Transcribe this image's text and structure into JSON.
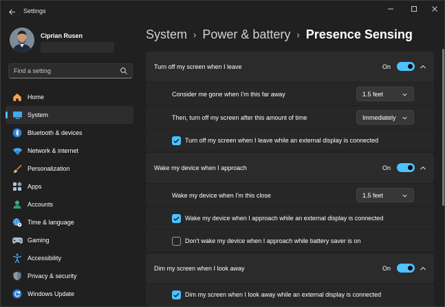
{
  "app": {
    "title": "Settings"
  },
  "user": {
    "name": "Ciprian Rusen"
  },
  "search": {
    "placeholder": "Find a setting"
  },
  "sidebar": {
    "items": [
      {
        "label": "Home",
        "icon": "home-icon"
      },
      {
        "label": "System",
        "icon": "system-icon",
        "active": true
      },
      {
        "label": "Bluetooth & devices",
        "icon": "bluetooth-icon"
      },
      {
        "label": "Network & internet",
        "icon": "wifi-icon"
      },
      {
        "label": "Personalization",
        "icon": "brush-icon"
      },
      {
        "label": "Apps",
        "icon": "apps-icon"
      },
      {
        "label": "Accounts",
        "icon": "accounts-icon"
      },
      {
        "label": "Time & language",
        "icon": "globe-clock-icon"
      },
      {
        "label": "Gaming",
        "icon": "gamepad-icon"
      },
      {
        "label": "Accessibility",
        "icon": "accessibility-icon"
      },
      {
        "label": "Privacy & security",
        "icon": "shield-icon"
      },
      {
        "label": "Windows Update",
        "icon": "update-icon"
      }
    ]
  },
  "breadcrumb": {
    "level1": "System",
    "level2": "Power & battery",
    "current": "Presence Sensing"
  },
  "sections": {
    "leave": {
      "title": "Turn off my screen when I leave",
      "state": "On",
      "distance_label": "Consider me gone when I'm this far away",
      "distance_value": "1.5 feet",
      "delay_label": "Then, turn off my screen after this amount of time",
      "delay_value": "Immediately",
      "external_label": "Turn off my screen when I leave while an external display is connected"
    },
    "approach": {
      "title": "Wake my device when I approach",
      "state": "On",
      "distance_label": "Wake my device when I'm this close",
      "distance_value": "1.5 feet",
      "external_label": "Wake my device when I approach while an external display is connected",
      "battery_label": "Don't wake my device when I approach while battery saver is on"
    },
    "dim": {
      "title": "Dim my screen when I look away",
      "state": "On",
      "external_label": "Dim my screen when I look away while an external display is connected"
    }
  },
  "colors": {
    "accent": "#4cc2ff",
    "background": "#202020",
    "card": "#2b2b2b"
  }
}
